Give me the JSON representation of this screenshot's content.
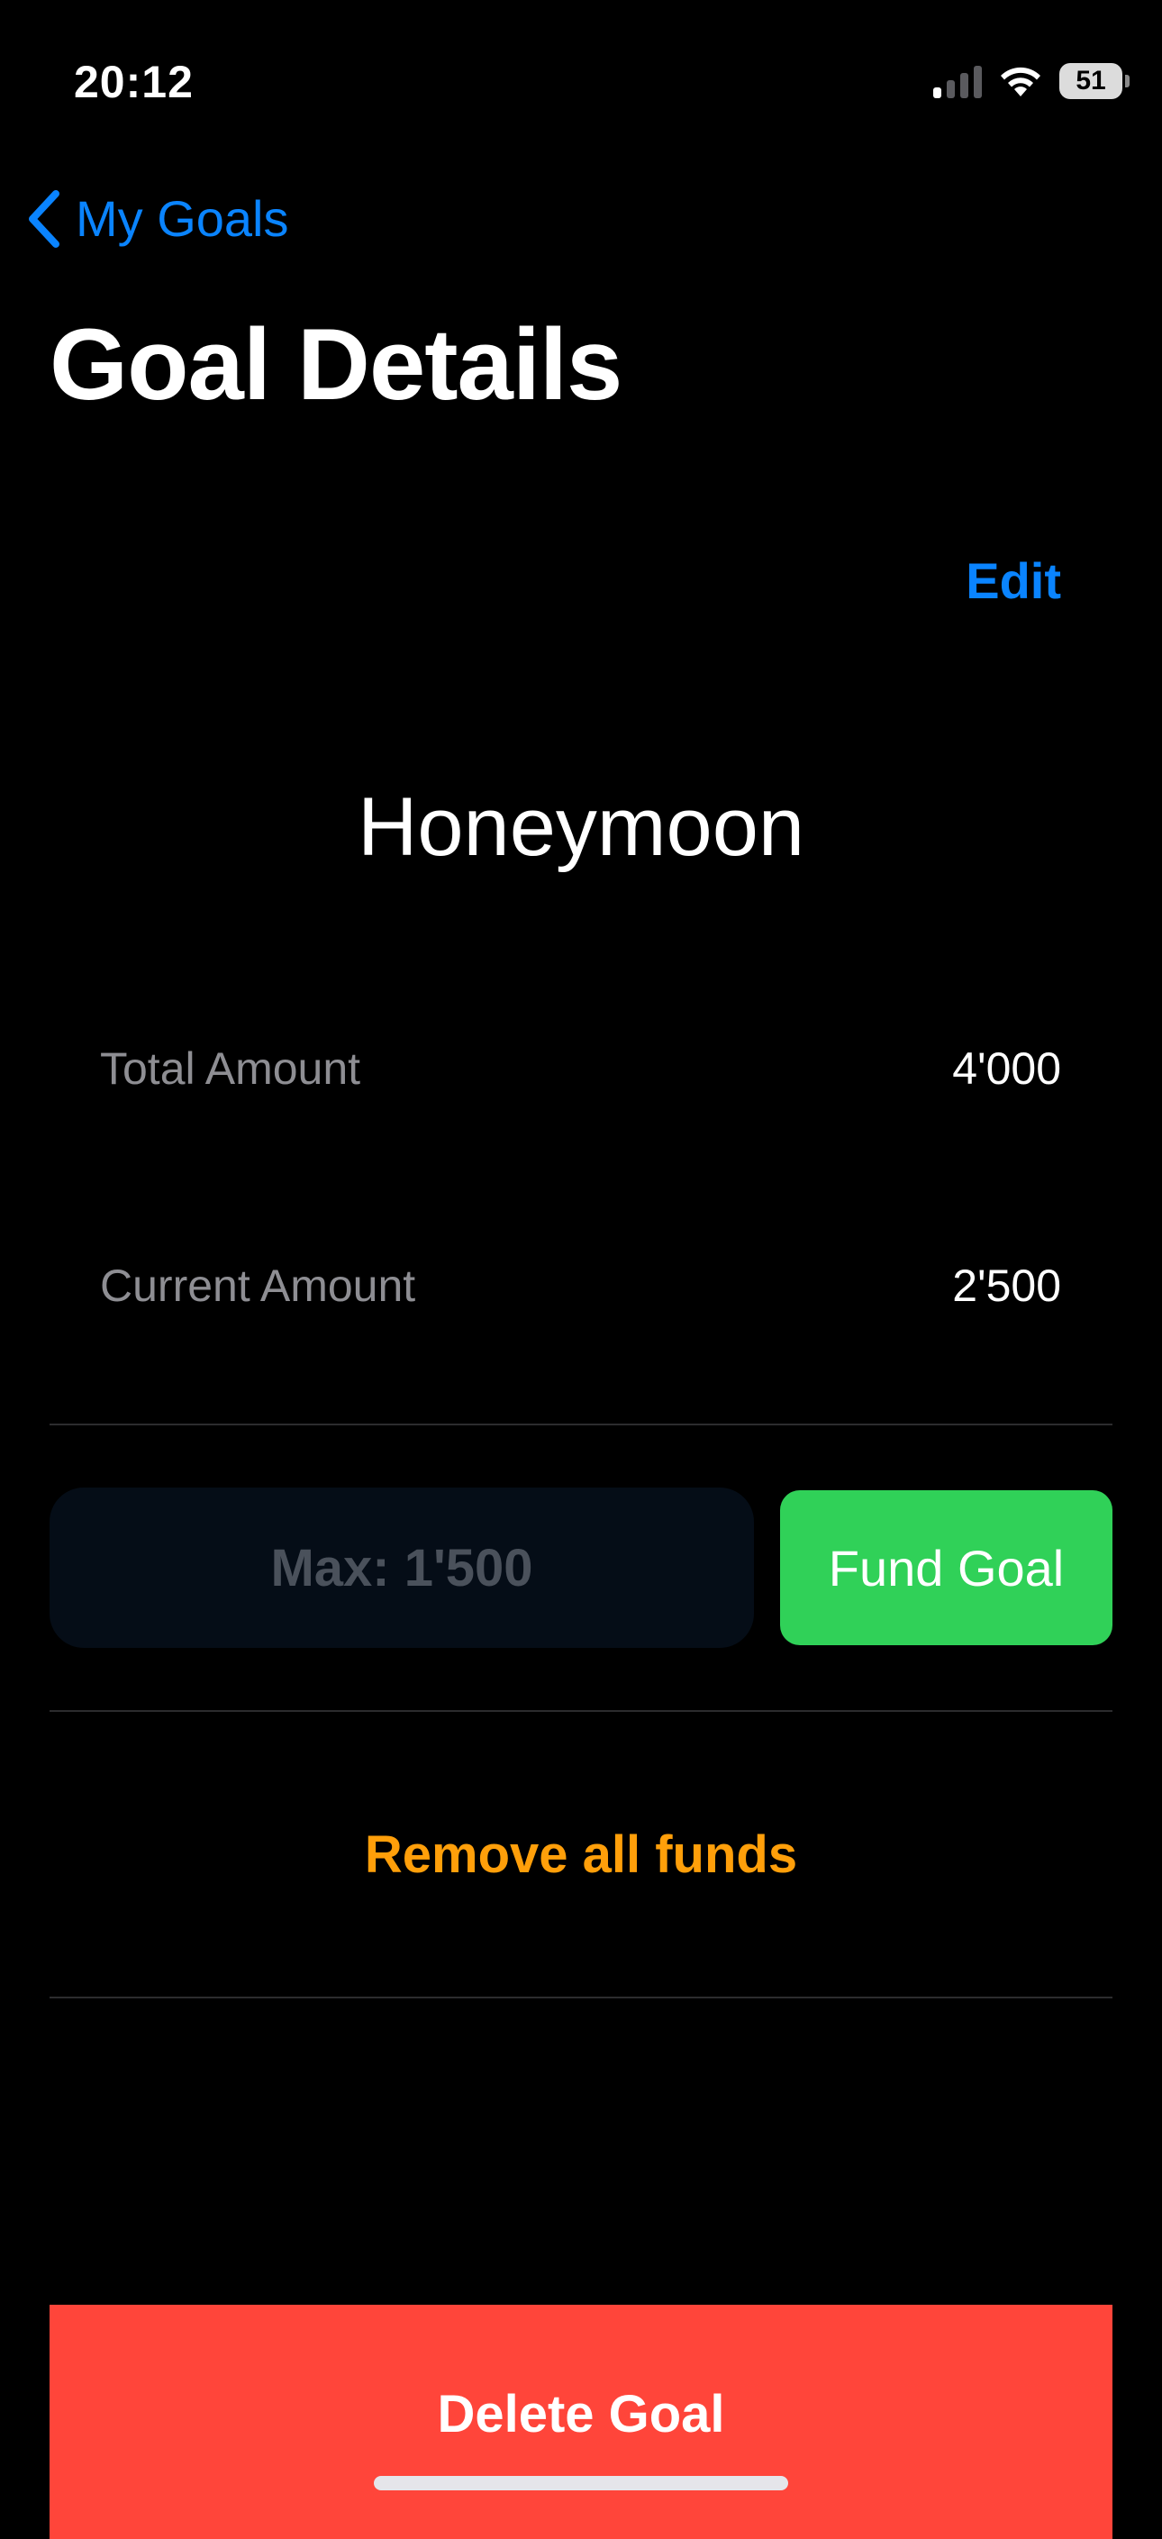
{
  "status_bar": {
    "time": "20:12",
    "battery_level": "51",
    "signal_bars_active": 1,
    "signal_bars_total": 4,
    "icons": [
      "signal-icon",
      "wifi-icon",
      "battery-icon"
    ]
  },
  "nav": {
    "back_label": "My Goals",
    "back_icon": "chevron-left-icon",
    "title": "Goal Details",
    "edit_label": "Edit"
  },
  "goal": {
    "name": "Honeymoon",
    "total_label": "Total Amount",
    "total_value": "4'000",
    "current_label": "Current Amount",
    "current_value": "2'500"
  },
  "funding": {
    "input_value": "",
    "input_placeholder": "Max: 1'500",
    "fund_button_label": "Fund Goal",
    "remove_label": "Remove all funds"
  },
  "actions": {
    "delete_label": "Delete Goal"
  },
  "colors": {
    "background": "#000000",
    "link_blue": "#0a84ff",
    "fund_green": "#30d158",
    "remove_orange": "#ff9f0a",
    "delete_red": "#ff453a",
    "secondary_text": "#8e8e93"
  }
}
